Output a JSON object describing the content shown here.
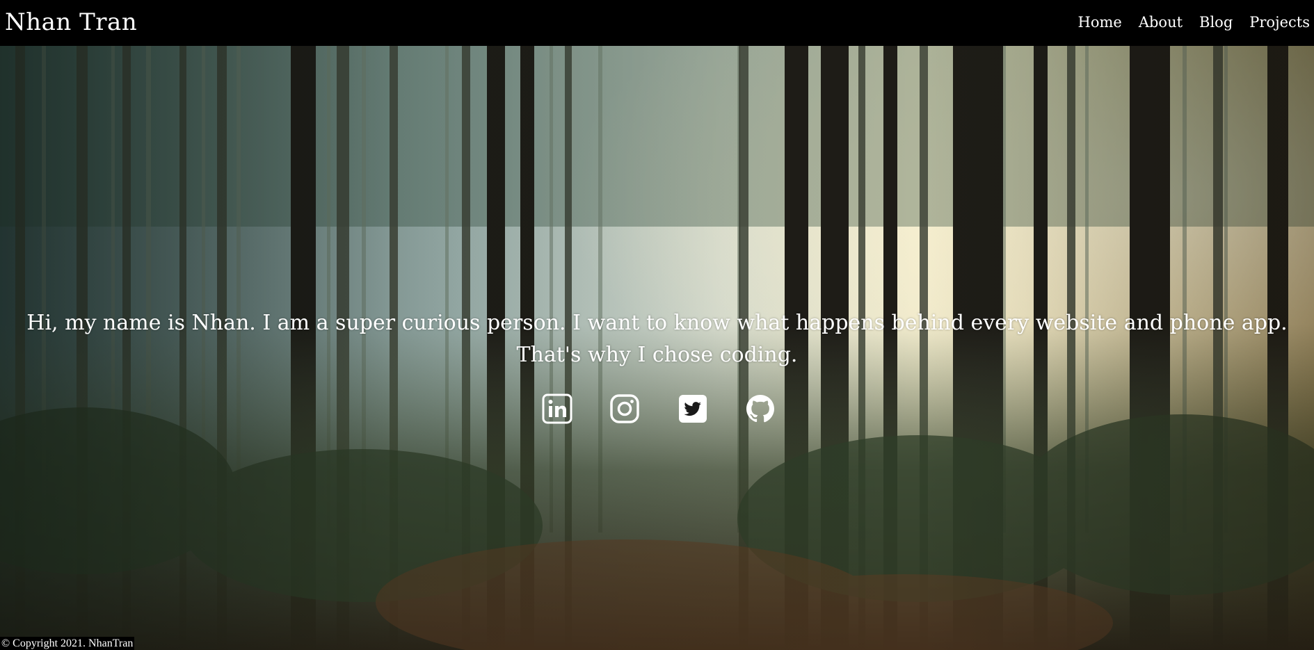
{
  "header": {
    "brand": "Nhan Tran",
    "nav": [
      {
        "label": "Home"
      },
      {
        "label": "About"
      },
      {
        "label": "Blog"
      },
      {
        "label": "Projects"
      }
    ]
  },
  "hero": {
    "intro_line_1": "Hi, my name is Nhan. I am a super curious person. I want to know what happens behind every website and phone app.",
    "intro_line_2": "That's why I chose coding.",
    "social_icons": [
      "linkedin-icon",
      "instagram-icon",
      "twitter-icon",
      "github-icon"
    ]
  },
  "footer": {
    "copyright": "© Copyright 2021. NhanTran"
  },
  "colors": {
    "navbar_bg": "#000000",
    "text": "#ffffff"
  }
}
